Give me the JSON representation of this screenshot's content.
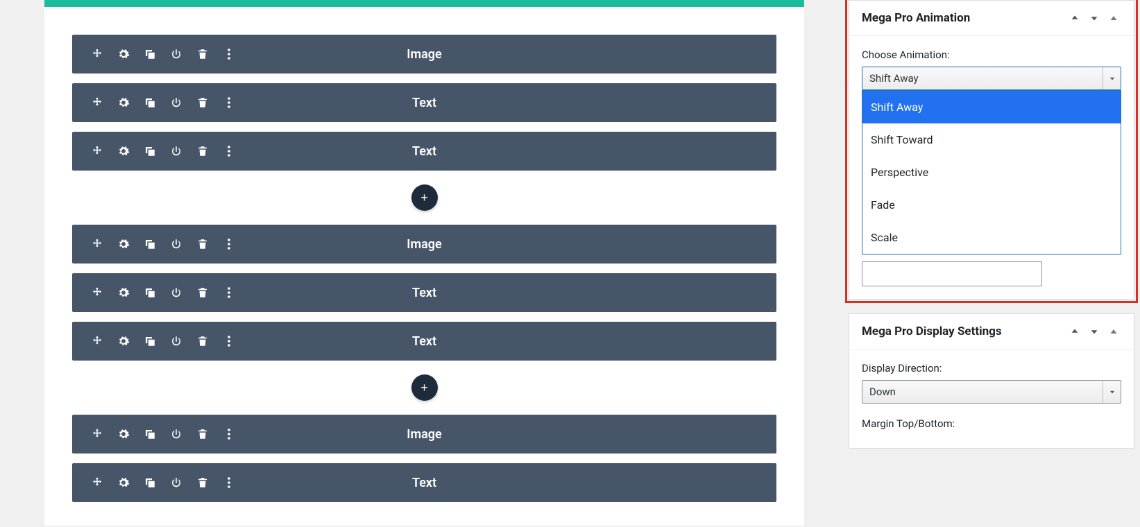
{
  "blocks": [
    {
      "label": "Image"
    },
    {
      "label": "Text"
    },
    {
      "label": "Text"
    },
    {
      "label": "Image"
    },
    {
      "label": "Text"
    },
    {
      "label": "Text"
    },
    {
      "label": "Image"
    },
    {
      "label": "Text"
    }
  ],
  "groupBreaks": [
    3,
    6
  ],
  "animationPanel": {
    "title": "Mega Pro Animation",
    "chooseLabel": "Choose Animation:",
    "selected": "Shift Away",
    "options": [
      "Shift Away",
      "Shift Toward",
      "Perspective",
      "Fade",
      "Scale"
    ]
  },
  "displayPanel": {
    "title": "Mega Pro Display Settings",
    "directionLabel": "Display Direction:",
    "directionValue": "Down",
    "marginLabel": "Margin Top/Bottom:"
  },
  "addLabel": "+",
  "colors": {
    "teal": "#1abc9c",
    "blockBg": "#475569",
    "highlight": "#d93025",
    "blue": "#2271f0"
  }
}
